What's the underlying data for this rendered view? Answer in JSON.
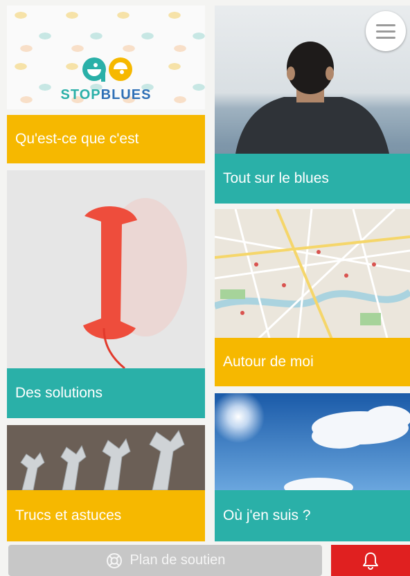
{
  "logo": {
    "brand_part1": "STOP",
    "brand_part2": "BLUES"
  },
  "tiles": {
    "quest": "Qu'est-ce que c'est",
    "blues": "Tout sur le blues",
    "solutions": "Des solutions",
    "autour": "Autour de moi",
    "trucs": "Trucs et astuces",
    "ou": "Où j'en suis ?"
  },
  "bottom_bar": {
    "support_label": "Plan de soutien"
  },
  "icons": {
    "menu": "hamburger-menu-icon",
    "support": "lifebuoy-icon",
    "alert": "bell-icon"
  },
  "colors": {
    "yellow": "#f6b800",
    "teal": "#2ab0a8",
    "alert": "#e02020",
    "support_bg": "#c7c7c7"
  }
}
